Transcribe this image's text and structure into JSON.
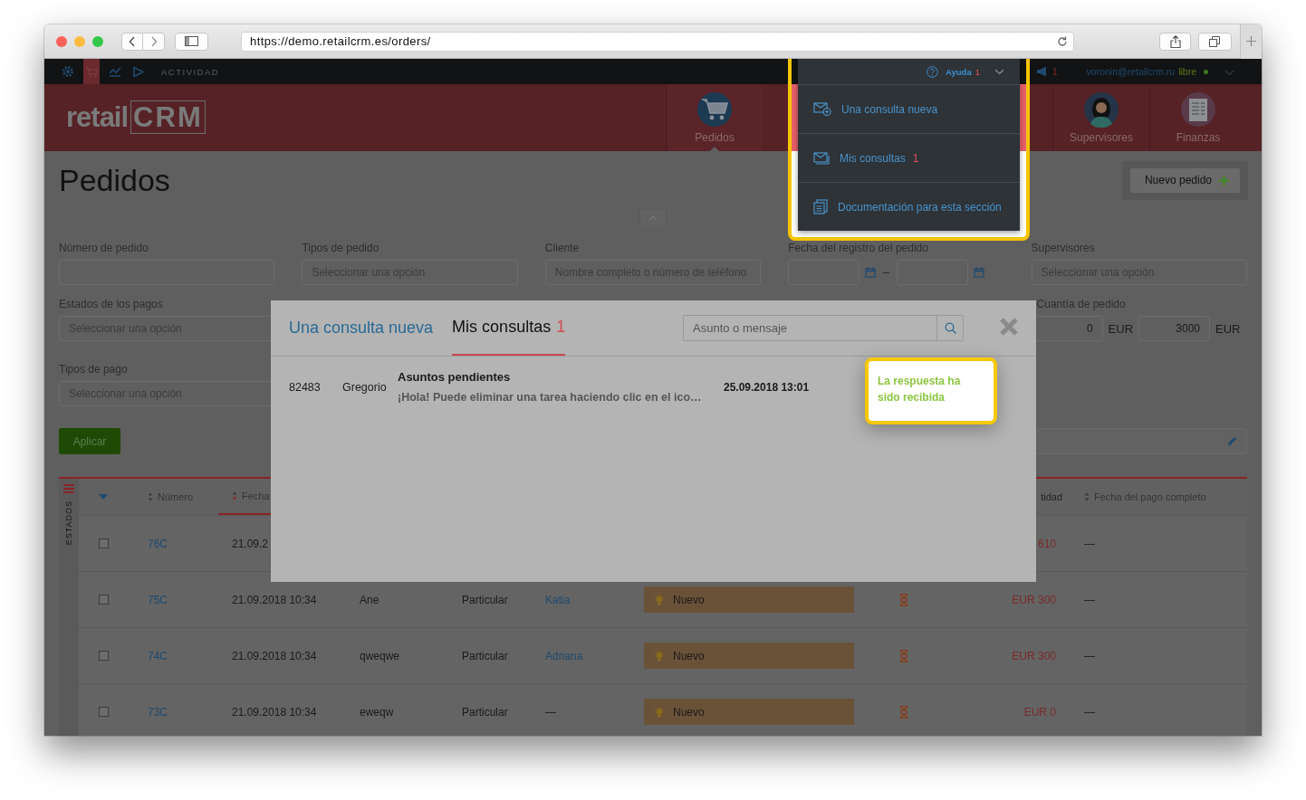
{
  "browser": {
    "url": "https://demo.retailcrm.es/orders/"
  },
  "top_bar": {
    "apps": [
      {
        "kind": "gear",
        "selected": false
      },
      {
        "kind": "cart",
        "selected": true
      },
      {
        "kind": "chart",
        "selected": false
      },
      {
        "kind": "play",
        "selected": false
      }
    ],
    "section_label": "ACTIVIDAD",
    "notifications_count": "1",
    "user_email": "voronin@retailcrm.ru",
    "plan": "libre"
  },
  "header": {
    "logo": [
      "retail",
      "CRM"
    ],
    "nav": [
      {
        "label": "Pedidos",
        "kind": "cart",
        "selected": true
      },
      {
        "label": "Supervisores",
        "kind": "person",
        "selected": false
      },
      {
        "label": "Finanzas",
        "kind": "ledger",
        "selected": false
      }
    ]
  },
  "help_menu": {
    "label": "Ayuda",
    "count": "1",
    "items": [
      {
        "label": "Una consulta nueva",
        "kind": "new"
      },
      {
        "label": "Mis consultas",
        "count": "1",
        "kind": "inbox"
      },
      {
        "label": "Documentación para esta sección",
        "kind": "docs"
      }
    ]
  },
  "page": {
    "title": "Pedidos",
    "new_order_button": "Nuevo pedido"
  },
  "filters": {
    "row_1": [
      {
        "label": "Número de pedido",
        "kind": "text"
      },
      {
        "label": "Tipos de pedido",
        "kind": "select",
        "placeholder": "Seleccionar una opción"
      },
      {
        "label": "Cliente",
        "kind": "text",
        "placeholder": "Nombre completo o número de teléfono"
      },
      {
        "label": "Fecha del registro del pedido",
        "kind": "date_range",
        "separator": "–"
      },
      {
        "label": "Supervisores",
        "kind": "select",
        "placeholder": "Seleccionar una opción"
      }
    ],
    "row_2": [
      {
        "label": "Estados de los pagos",
        "kind": "select",
        "placeholder": "Seleccionar una opción"
      },
      {
        "label": "Cuantía de pedido",
        "kind": "amount_range",
        "from": "0",
        "from_currency": "EUR",
        "to": "3000",
        "to_currency": "EUR"
      }
    ],
    "row_3": [
      {
        "label": "Tipos de pago",
        "kind": "select",
        "placeholder": "Seleccionar una opción"
      }
    ],
    "apply_button": "Aplicar"
  },
  "table": {
    "side_label": "ESTADOS",
    "columns": [
      {
        "label": "Número",
        "sorted": false
      },
      {
        "label": "Fecha",
        "sorted": true
      },
      {
        "label": "tidad",
        "sorted": false
      },
      {
        "label": "Fecha del pago completo",
        "sorted": false
      }
    ],
    "rows": [
      {
        "checked": false,
        "number": "76C",
        "date": "21.09.2",
        "amount": "610",
        "paid_date": "—"
      },
      {
        "checked": false,
        "number": "75C",
        "date": "21.09.2018 10:34",
        "client": "Ane",
        "type": "Particular",
        "manager": "Katia",
        "manager_assigned": true,
        "status": "Nuevo",
        "amount": "EUR 300",
        "paid_date": "—"
      },
      {
        "checked": false,
        "number": "74C",
        "date": "21.09.2018 10:34",
        "client": "qweqwe",
        "type": "Particular",
        "manager": "Adriana",
        "manager_assigned": true,
        "status": "Nuevo",
        "amount": "EUR 300",
        "paid_date": "—"
      },
      {
        "checked": false,
        "number": "73C",
        "date": "21.09.2018 10:34",
        "client": "eweqw",
        "type": "Particular",
        "manager": "—",
        "manager_assigned": false,
        "status": "Nuevo",
        "amount": "EUR 0",
        "paid_date": "—"
      }
    ]
  },
  "modal": {
    "tabs": [
      {
        "label": "Una consulta nueva",
        "selected": false
      },
      {
        "label": "Mis consultas",
        "count": "1",
        "selected": true
      }
    ],
    "search": {
      "placeholder": "Asunto o mensaje"
    },
    "rows": [
      {
        "number": "82483",
        "author": "Gregorio",
        "subject": "Asuntos pendientes",
        "preview": "¡Hola! Puede eliminar una tarea haciendo clic en el ico…",
        "date": "25.09.2018 13:01"
      }
    ]
  },
  "callout": {
    "text": "La respuesta ha sido recibida"
  }
}
